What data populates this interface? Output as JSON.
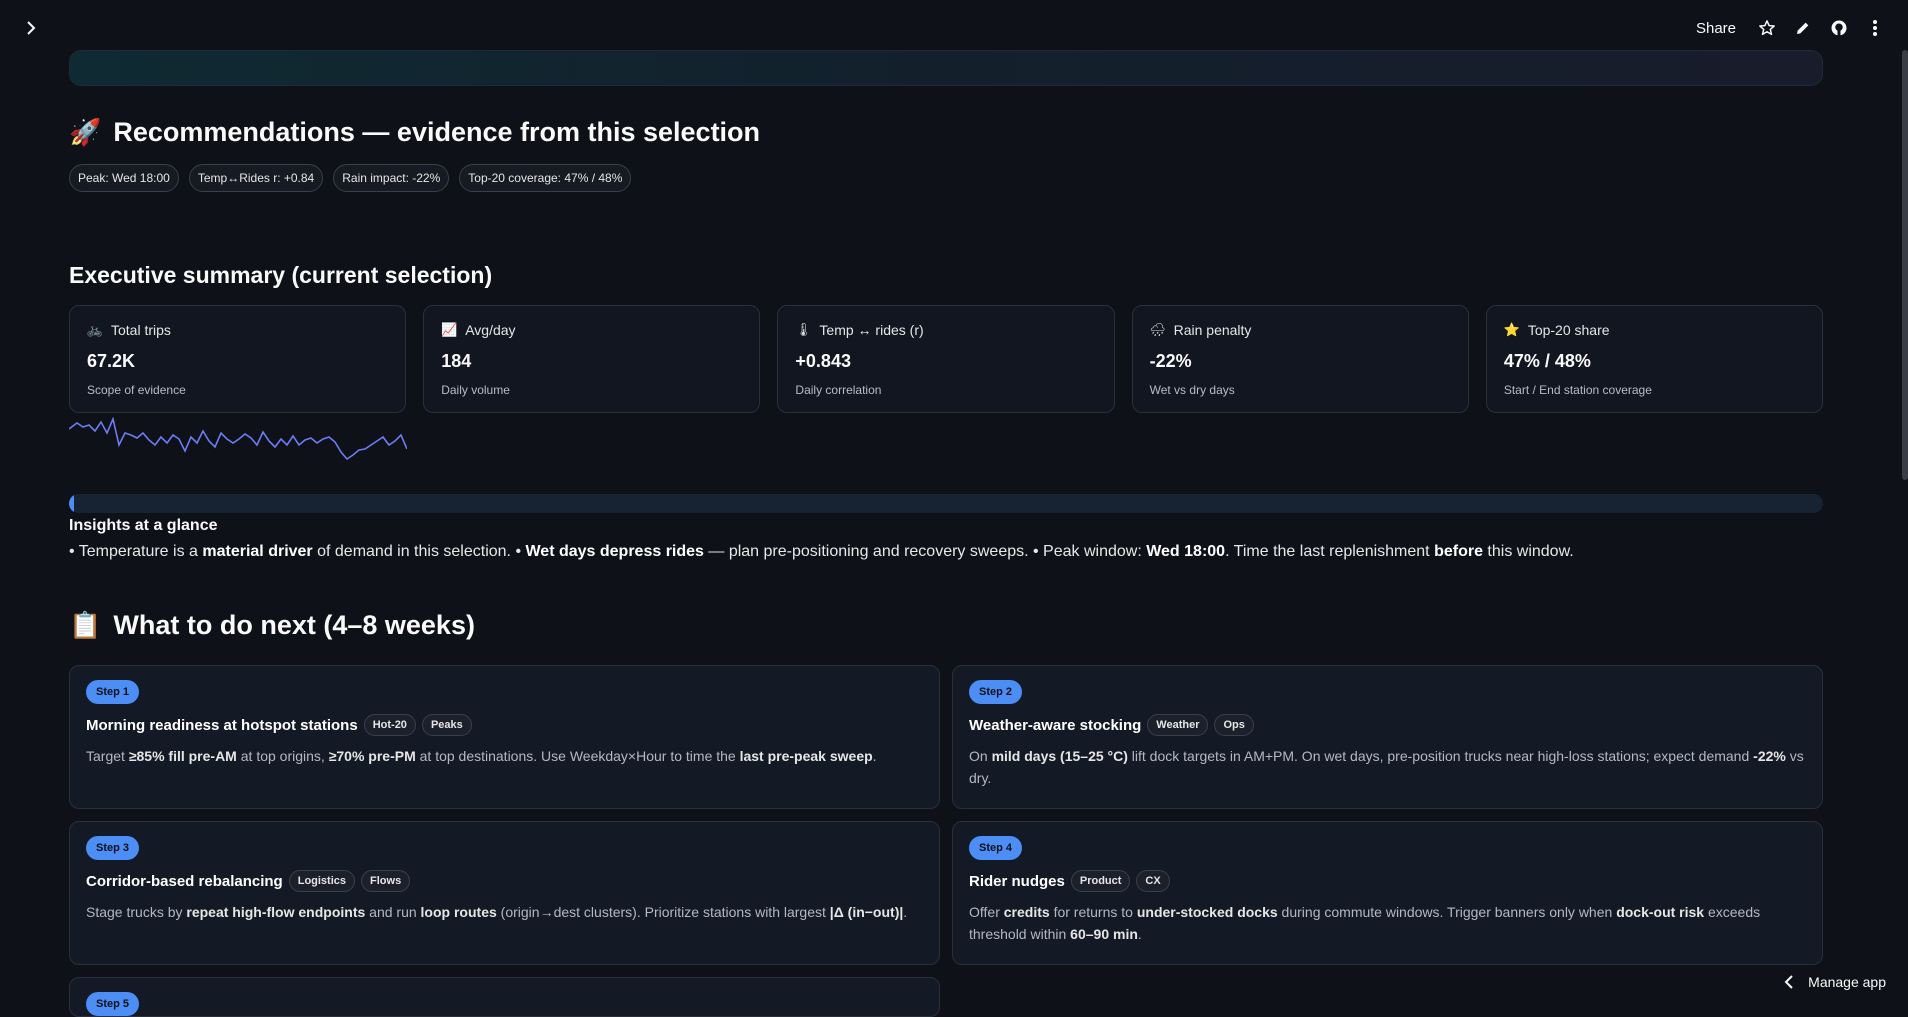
{
  "topbar": {
    "share_label": "Share",
    "icons": [
      "chevron-right-icon",
      "star-icon",
      "pencil-icon",
      "github-icon",
      "more-vertical-icon"
    ]
  },
  "recommendations": {
    "title": "Recommendations — evidence from this selection",
    "emoji": "🚀",
    "pills": [
      "Peak: Wed 18:00",
      "Temp↔Rides r: +0.84",
      "Rain impact: -22%",
      "Top-20 coverage: 47% / 48%"
    ]
  },
  "executive": {
    "title": "Executive summary (current selection)",
    "kpis": [
      {
        "emoji": "🚲",
        "label": "Total trips",
        "value": "67.2K",
        "sub": "Scope of evidence"
      },
      {
        "emoji": "📈",
        "label": "Avg/day",
        "value": "184",
        "sub": "Daily volume"
      },
      {
        "emoji": "🌡",
        "label": "Temp ↔ rides (r)",
        "value": "+0.843",
        "sub": "Daily correlation"
      },
      {
        "emoji": "🌧",
        "label": "Rain penalty",
        "value": "-22%",
        "sub": "Wet vs dry days"
      },
      {
        "emoji": "⭐",
        "label": "Top-20 share",
        "value": "47% / 48%",
        "sub": "Start / End station coverage"
      }
    ],
    "sparkline_color": "#6c7cf5",
    "progress_fraction": 0.003
  },
  "insights": {
    "title": "Insights at a glance",
    "p1": "• Temperature is a ",
    "b1": "material driver",
    "p2": " of demand in this selection. • ",
    "b2": "Wet days depress rides",
    "p3": " — plan pre-positioning and recovery sweeps. • Peak window: ",
    "b3": "Wed 18:00",
    "p4": ". Time the last replenishment ",
    "b4": "before",
    "p5": " this window."
  },
  "next": {
    "title": "What to do next (4–8 weeks)",
    "emoji": "📋",
    "steps": [
      {
        "badge": "Step 1",
        "title": "Morning readiness at hotspot stations",
        "tags": [
          "Hot-20",
          "Peaks"
        ],
        "body": [
          {
            "t": "Target ",
            "b": false
          },
          {
            "t": "≥85% fill pre-AM",
            "b": true
          },
          {
            "t": " at top origins, ",
            "b": false
          },
          {
            "t": "≥70% pre-PM",
            "b": true
          },
          {
            "t": " at top destinations. Use Weekday×Hour to time the ",
            "b": false
          },
          {
            "t": "last pre-peak sweep",
            "b": true
          },
          {
            "t": ".",
            "b": false
          }
        ]
      },
      {
        "badge": "Step 2",
        "title": "Weather-aware stocking",
        "tags": [
          "Weather",
          "Ops"
        ],
        "body": [
          {
            "t": "On ",
            "b": false
          },
          {
            "t": "mild days (15–25 °C)",
            "b": true
          },
          {
            "t": " lift dock targets in AM+PM. On wet days, pre-position trucks near high-loss stations; expect demand ",
            "b": false
          },
          {
            "t": "-22%",
            "b": true
          },
          {
            "t": " vs dry.",
            "b": false
          }
        ]
      },
      {
        "badge": "Step 3",
        "title": "Corridor-based rebalancing",
        "tags": [
          "Logistics",
          "Flows"
        ],
        "body": [
          {
            "t": "Stage trucks by ",
            "b": false
          },
          {
            "t": "repeat high-flow endpoints",
            "b": true
          },
          {
            "t": " and run ",
            "b": false
          },
          {
            "t": "loop routes",
            "b": true
          },
          {
            "t": " (origin→dest clusters). Prioritize stations with largest ",
            "b": false
          },
          {
            "t": "|Δ (in−out)|",
            "b": true
          },
          {
            "t": ".",
            "b": false
          }
        ]
      },
      {
        "badge": "Step 4",
        "title": "Rider nudges",
        "tags": [
          "Product",
          "CX"
        ],
        "body": [
          {
            "t": "Offer ",
            "b": false
          },
          {
            "t": "credits",
            "b": true
          },
          {
            "t": " for returns to ",
            "b": false
          },
          {
            "t": "under-stocked docks",
            "b": true
          },
          {
            "t": " during commute windows. Trigger banners only when ",
            "b": false
          },
          {
            "t": "dock-out risk",
            "b": true
          },
          {
            "t": " exceeds threshold within ",
            "b": false
          },
          {
            "t": "60–90 min",
            "b": true
          },
          {
            "t": ".",
            "b": false
          }
        ]
      }
    ],
    "step5_badge": "Step 5"
  },
  "footer": {
    "manage_label": "Manage app"
  }
}
